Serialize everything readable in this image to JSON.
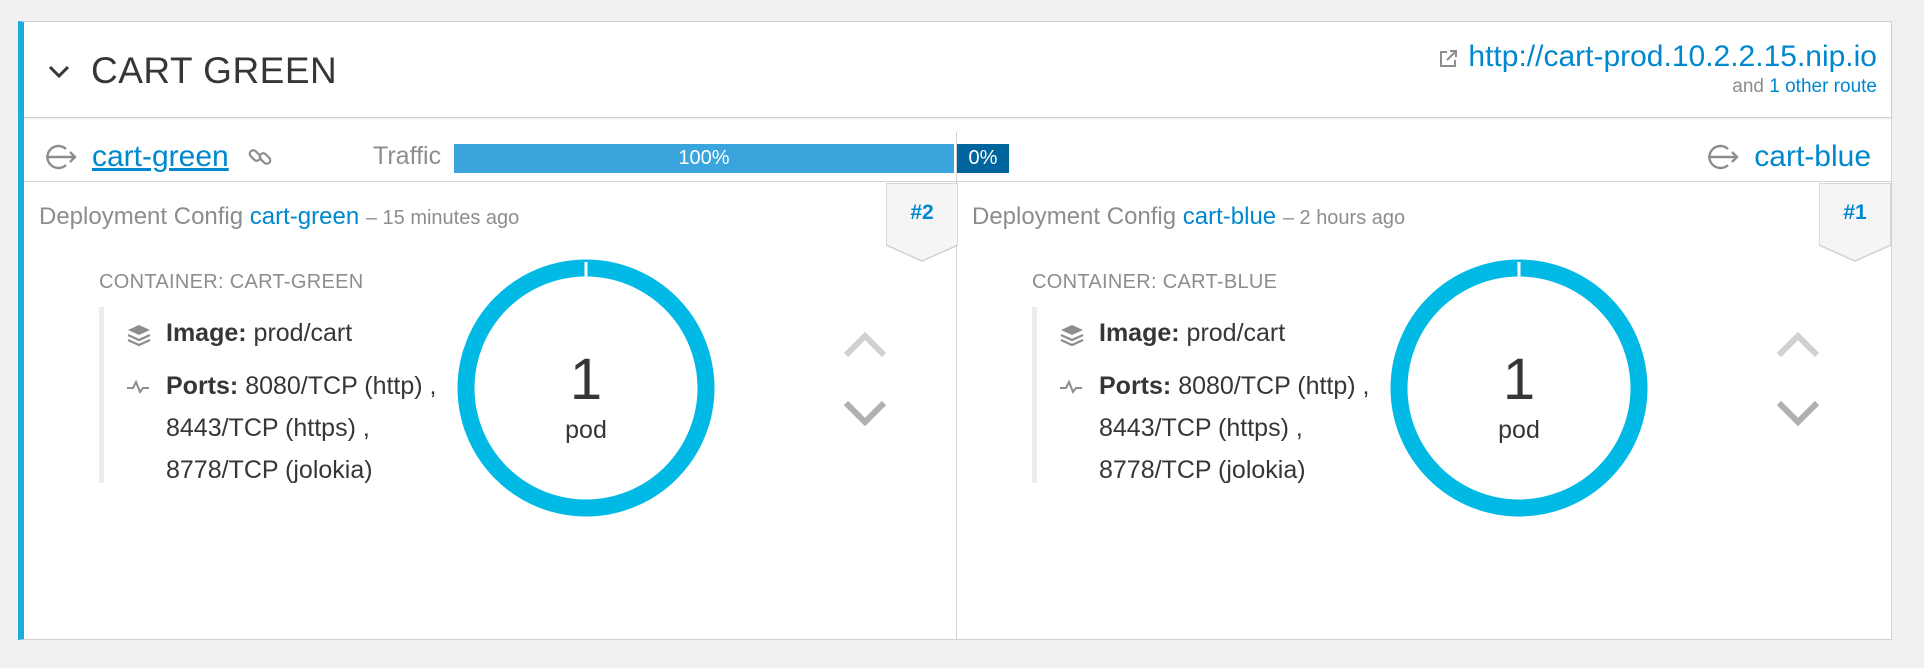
{
  "app": {
    "title": "CART GREEN",
    "route_url": "http://cart-prod.10.2.2.15.nip.io",
    "other_routes_prefix": "and",
    "other_routes_link": "1 other route"
  },
  "services": {
    "traffic_label": "Traffic",
    "green": {
      "name": "cart-green",
      "traffic_percent": 100,
      "traffic_label": "100%"
    },
    "blue": {
      "name": "cart-blue",
      "traffic_percent": 0,
      "traffic_label": "0%"
    }
  },
  "deployments": [
    {
      "dc_label": "Deployment Config",
      "dc_name": "cart-green",
      "time_ago": "– 15 minutes ago",
      "revision": "#2",
      "container_title": "CONTAINER: CART-GREEN",
      "image_label": "Image:",
      "image_value": "prod/cart",
      "ports_label": "Ports:",
      "ports": [
        "8080/TCP (http) ,",
        "8443/TCP (https) ,",
        "8778/TCP (jolokia)"
      ],
      "pod_count": "1",
      "pod_unit": "pod"
    },
    {
      "dc_label": "Deployment Config",
      "dc_name": "cart-blue",
      "time_ago": "– 2 hours ago",
      "revision": "#1",
      "container_title": "CONTAINER: CART-BLUE",
      "image_label": "Image:",
      "image_value": "prod/cart",
      "ports_label": "Ports:",
      "ports": [
        "8080/TCP (http) ,",
        "8443/TCP (https) ,",
        "8778/TCP (jolokia)"
      ],
      "pod_count": "1",
      "pod_unit": "pod"
    }
  ],
  "icons": {
    "collapse": "chevron-down-icon",
    "route": "external-link-icon",
    "service": "service-icon",
    "link": "chain-link-icon",
    "image": "layers-icon",
    "ports": "pulse-icon",
    "scale_up": "chevron-up-icon",
    "scale_down": "chevron-down-icon"
  },
  "colors": {
    "accent": "#1cacde",
    "link": "#0088ce",
    "donut": "#00b9e4",
    "traffic_primary": "#39a5dc",
    "traffic_secondary": "#00659c"
  }
}
